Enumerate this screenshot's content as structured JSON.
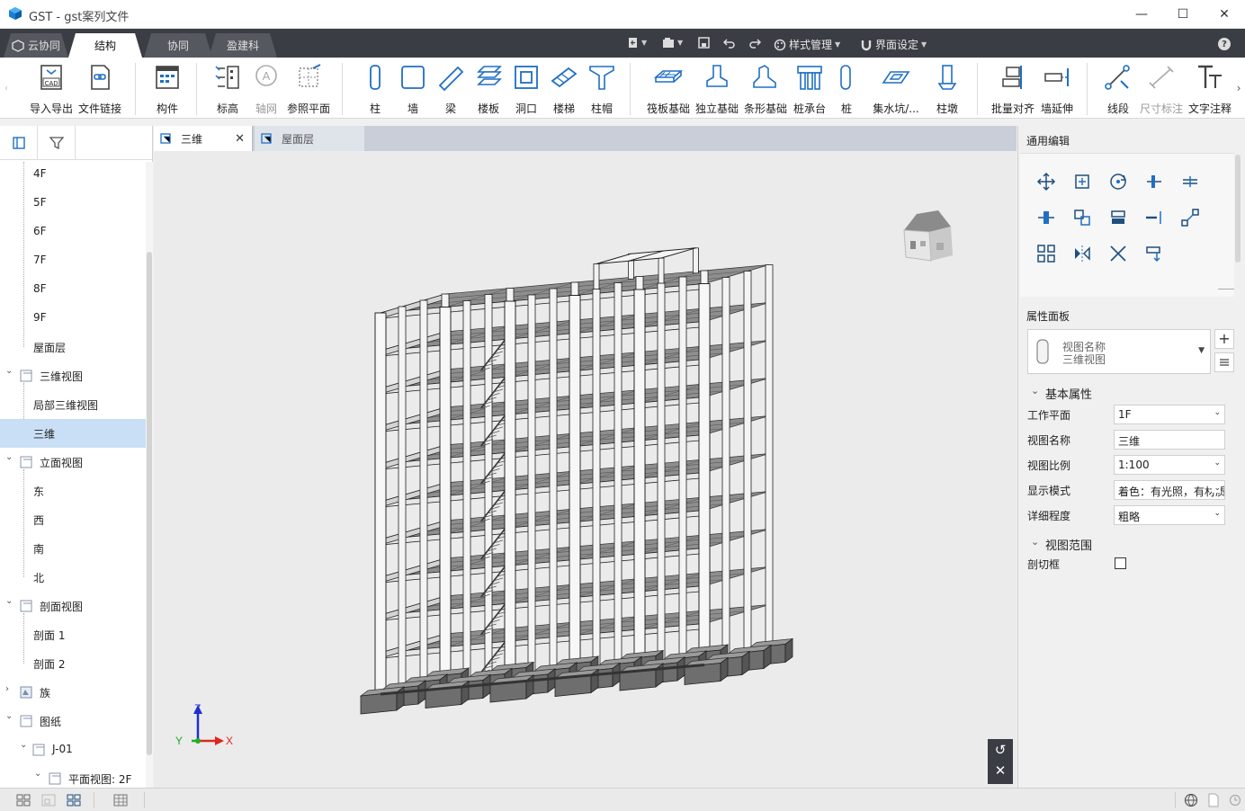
{
  "window": {
    "title": "GST - gst案列文件"
  },
  "menu": {
    "tabs": [
      "云协同",
      "结构",
      "协同",
      "盈建科"
    ],
    "style_manage": "样式管理",
    "ui_settings": "界面设定",
    "help": "?"
  },
  "ribbon": {
    "buttons": [
      "导入导出",
      "文件链接",
      "构件",
      "标高",
      "轴网",
      "参照平面",
      "柱",
      "墙",
      "梁",
      "楼板",
      "洞口",
      "楼梯",
      "柱帽",
      "筏板基础",
      "独立基础",
      "条形基础",
      "桩承台",
      "桩",
      "集水坑/...",
      "柱墩",
      "批量对齐",
      "墙延伸",
      "线段",
      "尺寸标注",
      "文字注释"
    ],
    "cad_badge": "CAD"
  },
  "tree": {
    "items": [
      "4F",
      "5F",
      "6F",
      "7F",
      "8F",
      "9F",
      "屋面层",
      "三维视图",
      "局部三维视图",
      "三维",
      "立面视图",
      "东",
      "西",
      "南",
      "北",
      "剖面视图",
      "剖面 1",
      "剖面 2",
      "族",
      "图纸",
      "J-01",
      "平面视图: 2F"
    ]
  },
  "doc_tabs": [
    "三维",
    "屋面层"
  ],
  "viewport": {
    "axis_x": "X",
    "axis_y": "Y",
    "axis_z": "Z"
  },
  "right_panel": {
    "general_edit_title": "通用编辑",
    "property_panel_title": "属性面板",
    "view_type_label": "视图名称",
    "view_type_value": "三维视图",
    "section_basic": "基本属性",
    "props": [
      {
        "label": "工作平面",
        "value": "1F"
      },
      {
        "label": "视图名称",
        "value": "三维"
      },
      {
        "label": "视图比例",
        "value": "1:100"
      },
      {
        "label": "显示模式",
        "value": "着色：有光照，有材质"
      },
      {
        "label": "详细程度",
        "value": "粗略"
      }
    ],
    "section_range": "视图范围",
    "cut_box_label": "剖切框"
  },
  "colors": {
    "menubar": "#3a3d44",
    "selection": "#c9dff5",
    "viewport_bg": "#ebebeb",
    "accent_blue": "#1f6fc5"
  }
}
